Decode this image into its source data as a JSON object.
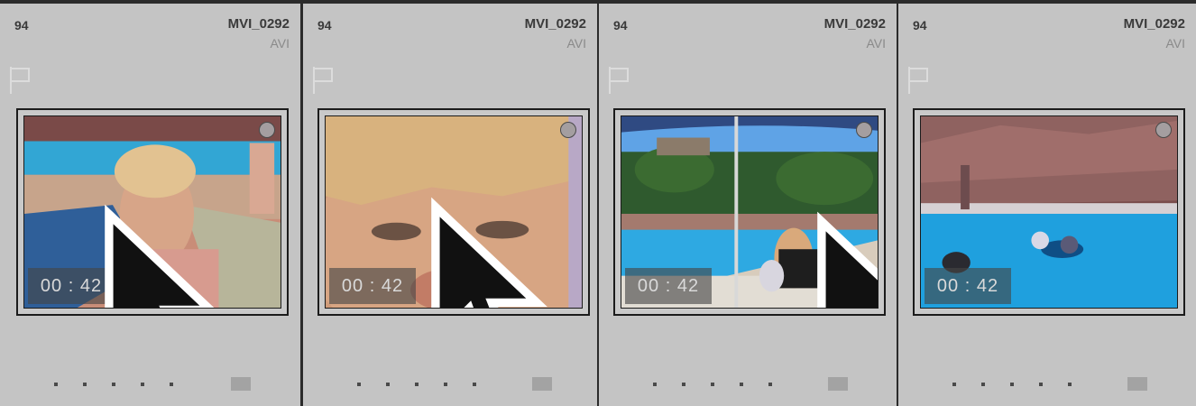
{
  "grid": {
    "cells": [
      {
        "index": "94",
        "filename": "MVI_0292",
        "filetype": "AVI",
        "duration": "00 : 42",
        "rating_dots": 5
      },
      {
        "index": "94",
        "filename": "MVI_0292",
        "filetype": "AVI",
        "duration": "00 : 42",
        "rating_dots": 5
      },
      {
        "index": "94",
        "filename": "MVI_0292",
        "filetype": "AVI",
        "duration": "00 : 42",
        "rating_dots": 5
      },
      {
        "index": "94",
        "filename": "MVI_0292",
        "filetype": "AVI",
        "duration": "00 : 42",
        "rating_dots": 5
      }
    ]
  },
  "icons": {
    "flag": "flag-icon",
    "badge": "selection-circle-icon",
    "cursor": "mouse-pointer-icon",
    "mini": "color-label-icon"
  },
  "colors": {
    "cell_bg": "#c4c4c4",
    "separator": "#2b2b2b",
    "duration_bg": "#464646"
  }
}
